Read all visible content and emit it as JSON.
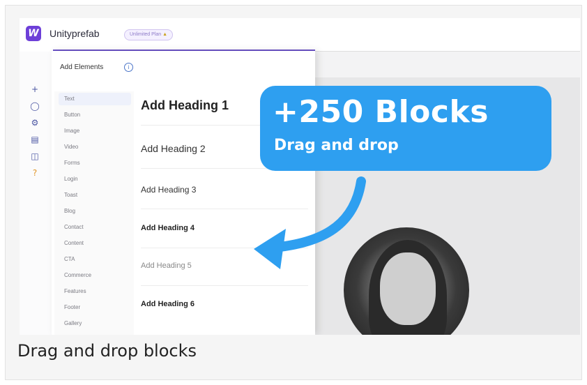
{
  "app": {
    "brand": "Unityprefab",
    "logo_letter": "W",
    "plan_badge": "Unlimited Plan"
  },
  "side_rail": {
    "icons": [
      "plus-icon",
      "pages-icon",
      "settings-icon",
      "layout-icon",
      "storage-icon",
      "help-icon"
    ]
  },
  "panel": {
    "title": "Add Elements",
    "categories": [
      "Text",
      "Button",
      "Image",
      "Video",
      "Forms",
      "Login",
      "Toast",
      "Blog",
      "Contact",
      "Content",
      "CTA",
      "Commerce",
      "Features",
      "Footer",
      "Gallery"
    ],
    "active_category": "Text",
    "headings": [
      "Add Heading 1",
      "Add Heading 2",
      "Add Heading 3",
      "Add Heading 4",
      "Add Heading 5",
      "Add Heading 6"
    ]
  },
  "callout": {
    "headline": "+250 Blocks",
    "subline": "Drag and drop",
    "color": "#2e9ff0"
  },
  "caption": "Drag and drop blocks",
  "colors": {
    "brand_purple": "#6d3fd8",
    "accent_blue": "#2e9ff0"
  }
}
